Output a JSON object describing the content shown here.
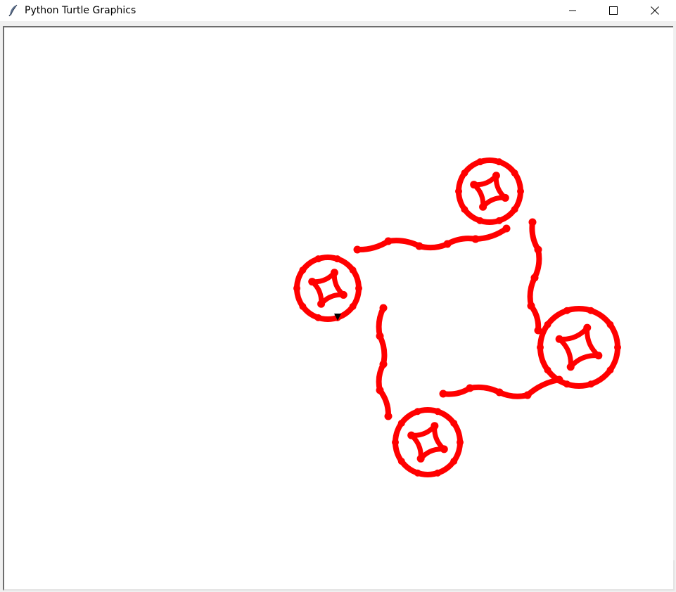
{
  "window": {
    "title": "Python Turtle Graphics",
    "app_icon": "feather-icon",
    "controls": {
      "minimize_icon": "minimize-icon",
      "maximize_icon": "maximize-icon",
      "close_icon": "close-icon"
    }
  },
  "canvas": {
    "background": "#ffffff",
    "pen_color": "#ff0000",
    "turtle_color": "#000000",
    "turtle_icon": "turtle-arrow-icon"
  }
}
